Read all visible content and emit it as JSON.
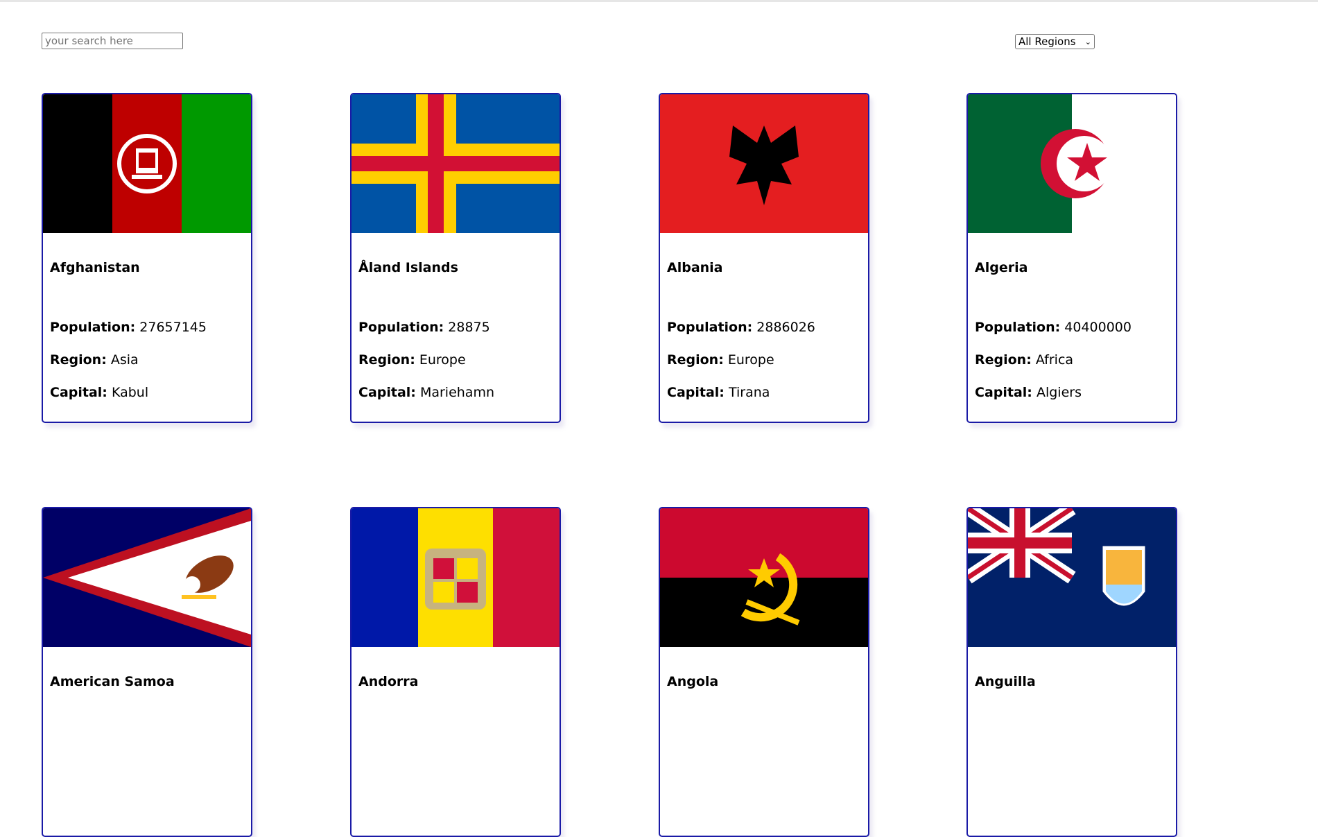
{
  "search": {
    "placeholder": "your search here"
  },
  "region_filter": {
    "selected": "All Regions"
  },
  "labels": {
    "population": "Population:",
    "region": "Region:",
    "capital": "Capital:"
  },
  "countries": [
    {
      "name": "Afghanistan",
      "population": "27657145",
      "region": "Asia",
      "capital": "Kabul"
    },
    {
      "name": "Åland Islands",
      "population": "28875",
      "region": "Europe",
      "capital": "Mariehamn"
    },
    {
      "name": "Albania",
      "population": "2886026",
      "region": "Europe",
      "capital": "Tirana"
    },
    {
      "name": "Algeria",
      "population": "40400000",
      "region": "Africa",
      "capital": "Algiers"
    },
    {
      "name": "American Samoa",
      "population": "",
      "region": "",
      "capital": ""
    },
    {
      "name": "Andorra",
      "population": "",
      "region": "",
      "capital": ""
    },
    {
      "name": "Angola",
      "population": "",
      "region": "",
      "capital": ""
    },
    {
      "name": "Anguilla",
      "population": "",
      "region": "",
      "capital": ""
    }
  ],
  "colors": {
    "card_border": "#1a1aa6"
  }
}
